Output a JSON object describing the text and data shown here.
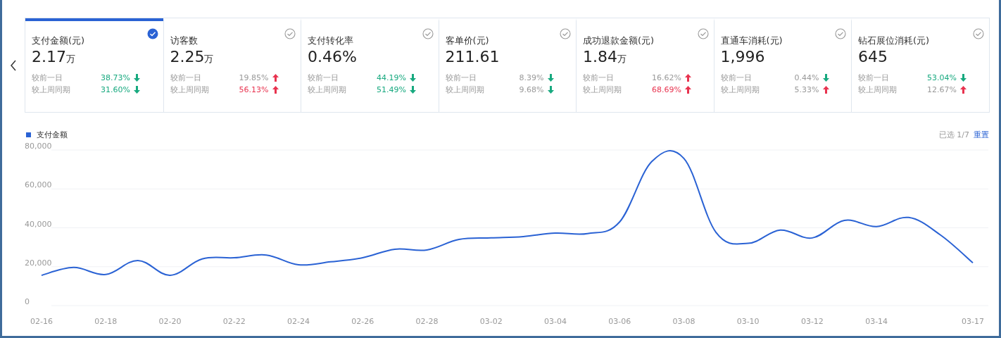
{
  "cards": [
    {
      "title": "支付金额(元)",
      "value": "2.17",
      "unit": "万",
      "selected": true,
      "compare": [
        {
          "label": "较前一日",
          "value": "38.73%",
          "up": false,
          "highlighted": true
        },
        {
          "label": "较上周同期",
          "value": "31.60%",
          "up": false,
          "highlighted": true
        }
      ]
    },
    {
      "title": "访客数",
      "value": "2.25",
      "unit": "万",
      "selected": false,
      "compare": [
        {
          "label": "较前一日",
          "value": "19.85%",
          "up": true,
          "highlighted": false
        },
        {
          "label": "较上周同期",
          "value": "56.13%",
          "up": true,
          "highlighted": true
        }
      ]
    },
    {
      "title": "支付转化率",
      "value": "0.46%",
      "selected": false,
      "compare": [
        {
          "label": "较前一日",
          "value": "44.19%",
          "up": false,
          "highlighted": true
        },
        {
          "label": "较上周同期",
          "value": "51.49%",
          "up": false,
          "highlighted": true
        }
      ]
    },
    {
      "title": "客单价(元)",
      "value": "211.61",
      "selected": false,
      "compare": [
        {
          "label": "较前一日",
          "value": "8.39%",
          "up": false,
          "highlighted": false
        },
        {
          "label": "较上周同期",
          "value": "9.68%",
          "up": false,
          "highlighted": false
        }
      ]
    },
    {
      "title": "成功退款金额(元)",
      "value": "1.84",
      "unit": "万",
      "selected": false,
      "compare": [
        {
          "label": "较前一日",
          "value": "16.62%",
          "up": true,
          "highlighted": false
        },
        {
          "label": "较上周同期",
          "value": "68.69%",
          "up": true,
          "highlighted": true
        }
      ]
    },
    {
      "title": "直通车消耗(元)",
      "value": "1,996",
      "selected": false,
      "compare": [
        {
          "label": "较前一日",
          "value": "0.44%",
          "up": false,
          "highlighted": false
        },
        {
          "label": "较上周同期",
          "value": "5.33%",
          "up": true,
          "highlighted": false
        }
      ]
    },
    {
      "title": "钻石展位消耗(元)",
      "value": "645",
      "selected": false,
      "compare": [
        {
          "label": "较前一日",
          "value": "53.04%",
          "up": false,
          "highlighted": true
        },
        {
          "label": "较上周同期",
          "value": "12.67%",
          "up": true,
          "highlighted": false
        }
      ]
    }
  ],
  "chart": {
    "selection_count": "已选 1/7",
    "reset_link": "重置",
    "chart_data": {
      "type": "line",
      "categories": [
        "02-16",
        null,
        "02-18",
        null,
        "02-20",
        null,
        "02-22",
        null,
        "02-24",
        null,
        "02-26",
        null,
        "02-28",
        null,
        "03-02",
        null,
        "03-04",
        null,
        "03-06",
        null,
        "03-08",
        null,
        "03-10",
        null,
        "03-12",
        null,
        "03-14",
        null,
        null,
        "03-17"
      ],
      "grid": true,
      "series": [
        {
          "name": "支付金额",
          "color": "#2a62d4",
          "values": [
            15600,
            19600,
            16000,
            23200,
            15600,
            24000,
            24600,
            26000,
            21000,
            22500,
            24600,
            29000,
            28600,
            34000,
            34800,
            35500,
            37300,
            37000,
            43000,
            74000,
            75700,
            37700,
            32000,
            38800,
            34800,
            43800,
            40600,
            45300,
            36200,
            22000
          ]
        }
      ],
      "ylim": [
        0,
        80000
      ],
      "yticks": [
        {
          "value": 0,
          "label": "0"
        },
        {
          "value": 20000,
          "label": "20,000"
        },
        {
          "value": 40000,
          "label": "40,000"
        },
        {
          "value": 60000,
          "label": "60,000"
        },
        {
          "value": 80000,
          "label": "80,000"
        }
      ]
    }
  }
}
